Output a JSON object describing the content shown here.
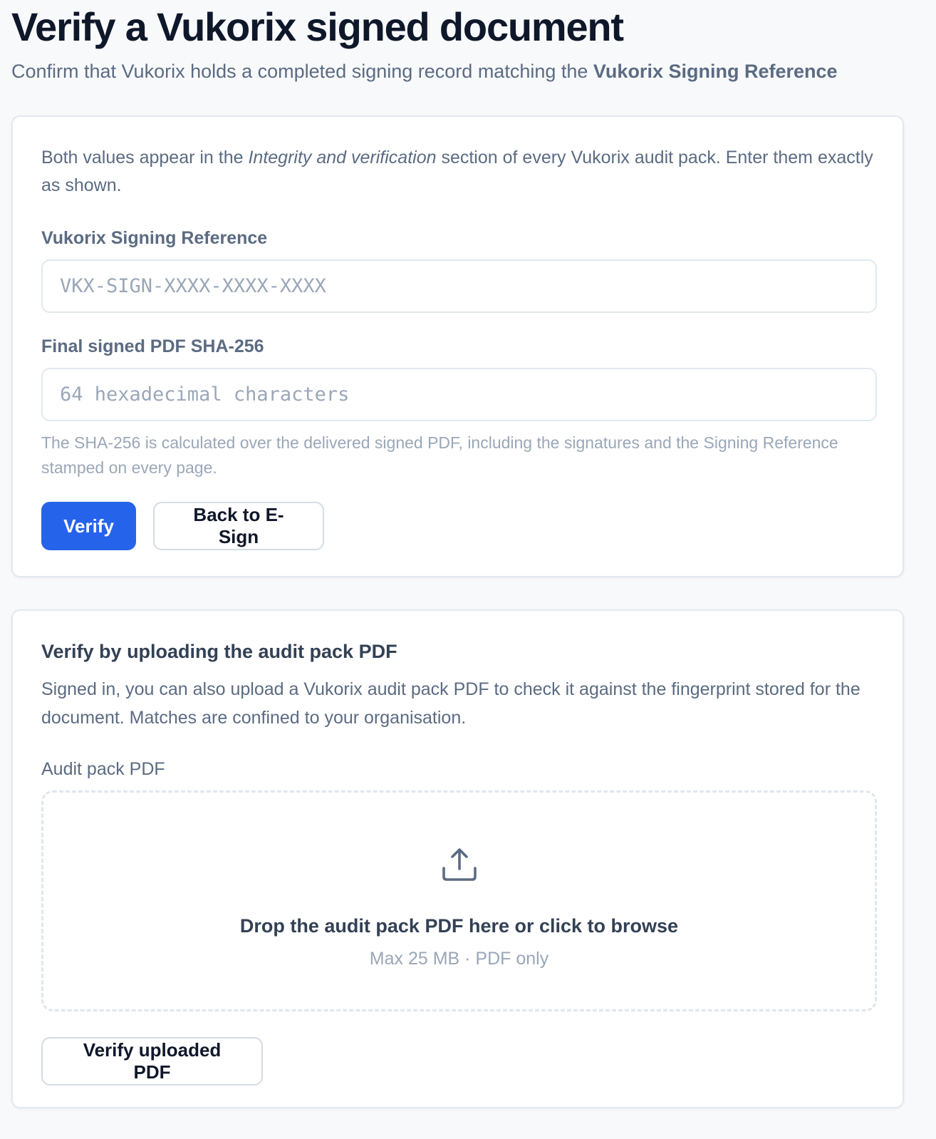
{
  "header": {
    "title": "Verify a Vukorix signed document",
    "subtitle_prefix": "Confirm that Vukorix holds a completed signing record matching the ",
    "subtitle_emphasis": "Vukorix Signing Reference"
  },
  "manual_form": {
    "intro_prefix": "Both values appear in the ",
    "intro_emphasis": "Integrity and verification",
    "intro_suffix": " section of every Vukorix audit pack. Enter them exactly as shown.",
    "reference_label": "Vukorix Signing Reference",
    "reference_value": "",
    "reference_placeholder": "VKX-SIGN-XXXX-XXXX-XXXX",
    "sha_label": "Final signed PDF SHA-256",
    "sha_value": "",
    "sha_placeholder": "64 hexadecimal characters",
    "sha_hint": "The SHA-256 is calculated over the delivered signed PDF, including the signatures and the Signing Reference stamped on every page.",
    "verify_label": "Verify",
    "back_label": "Back to E-Sign"
  },
  "upload_form": {
    "title": "Verify by uploading the audit pack PDF",
    "description": "Signed in, you can also upload a Vukorix audit pack PDF to check it against the fingerprint stored for the document. Matches are confined to your organisation.",
    "field_label": "Audit pack PDF",
    "dropzone_icon": "upload-icon",
    "dropzone_title": "Drop the audit pack PDF here or click to browse",
    "dropzone_meta": "Max 25 MB · PDF only",
    "verify_upload_label": "Verify uploaded PDF"
  },
  "colors": {
    "accent": "#2563eb",
    "heading": "#0f172a",
    "muted_text": "#5b6b82",
    "hint_text": "#9aa7b8",
    "border": "#e3e8ef",
    "background": "#f8f9fb"
  }
}
